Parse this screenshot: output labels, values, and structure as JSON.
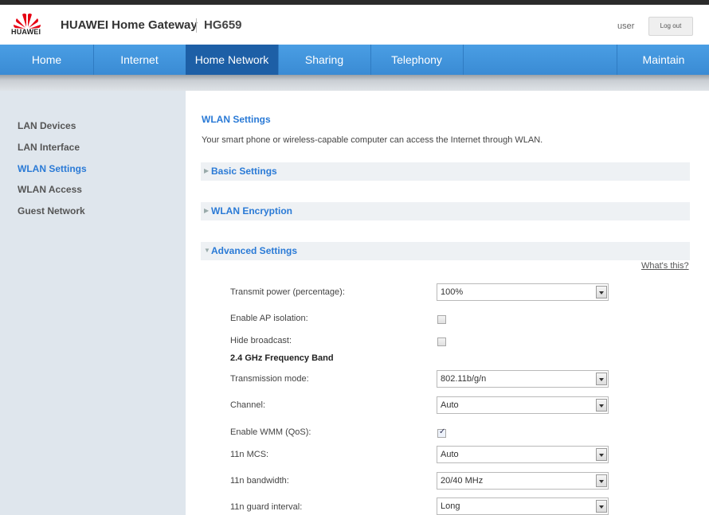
{
  "header": {
    "brand": "HUAWEI",
    "title": "HUAWEI Home Gateway",
    "model": "HG659",
    "user": "user",
    "logout_label": "Log out"
  },
  "nav": {
    "items": [
      "Home",
      "Internet",
      "Home Network",
      "Sharing",
      "Telephony"
    ],
    "maintain": "Maintain",
    "active": "Home Network"
  },
  "sidebar": {
    "items": [
      "LAN Devices",
      "LAN Interface",
      "WLAN Settings",
      "WLAN Access",
      "Guest Network"
    ],
    "active": "WLAN Settings"
  },
  "main": {
    "section_title": "WLAN Settings",
    "description": "Your smart phone or wireless-capable computer can access the Internet through WLAN.",
    "accordions": [
      "Basic Settings",
      "WLAN Encryption",
      "Advanced Settings"
    ],
    "whats_this": "What's this?",
    "transmit_power": {
      "label": "Transmit power (percentage):",
      "value": "100%"
    },
    "ap_isolation": {
      "label": "Enable AP isolation:",
      "checked": false
    },
    "hide_broadcast": {
      "label": "Hide broadcast:",
      "checked": false
    },
    "band_title": "2.4 GHz Frequency Band",
    "transmission_mode": {
      "label": "Transmission mode:",
      "value": "802.11b/g/n"
    },
    "channel": {
      "label": "Channel:",
      "value": "Auto"
    },
    "wmm": {
      "label": "Enable WMM (QoS):",
      "checked": true
    },
    "mcs": {
      "label": "11n MCS:",
      "value": "Auto"
    },
    "bandwidth": {
      "label": "11n bandwidth:",
      "value": "20/40 MHz"
    },
    "guard_interval": {
      "label": "11n guard interval:",
      "value": "Long"
    }
  },
  "colors": {
    "accent": "#2a7ad6",
    "nav_active": "#1d5fa6",
    "nav_bg": "#3a8bd4",
    "logo_red": "#e60012"
  }
}
